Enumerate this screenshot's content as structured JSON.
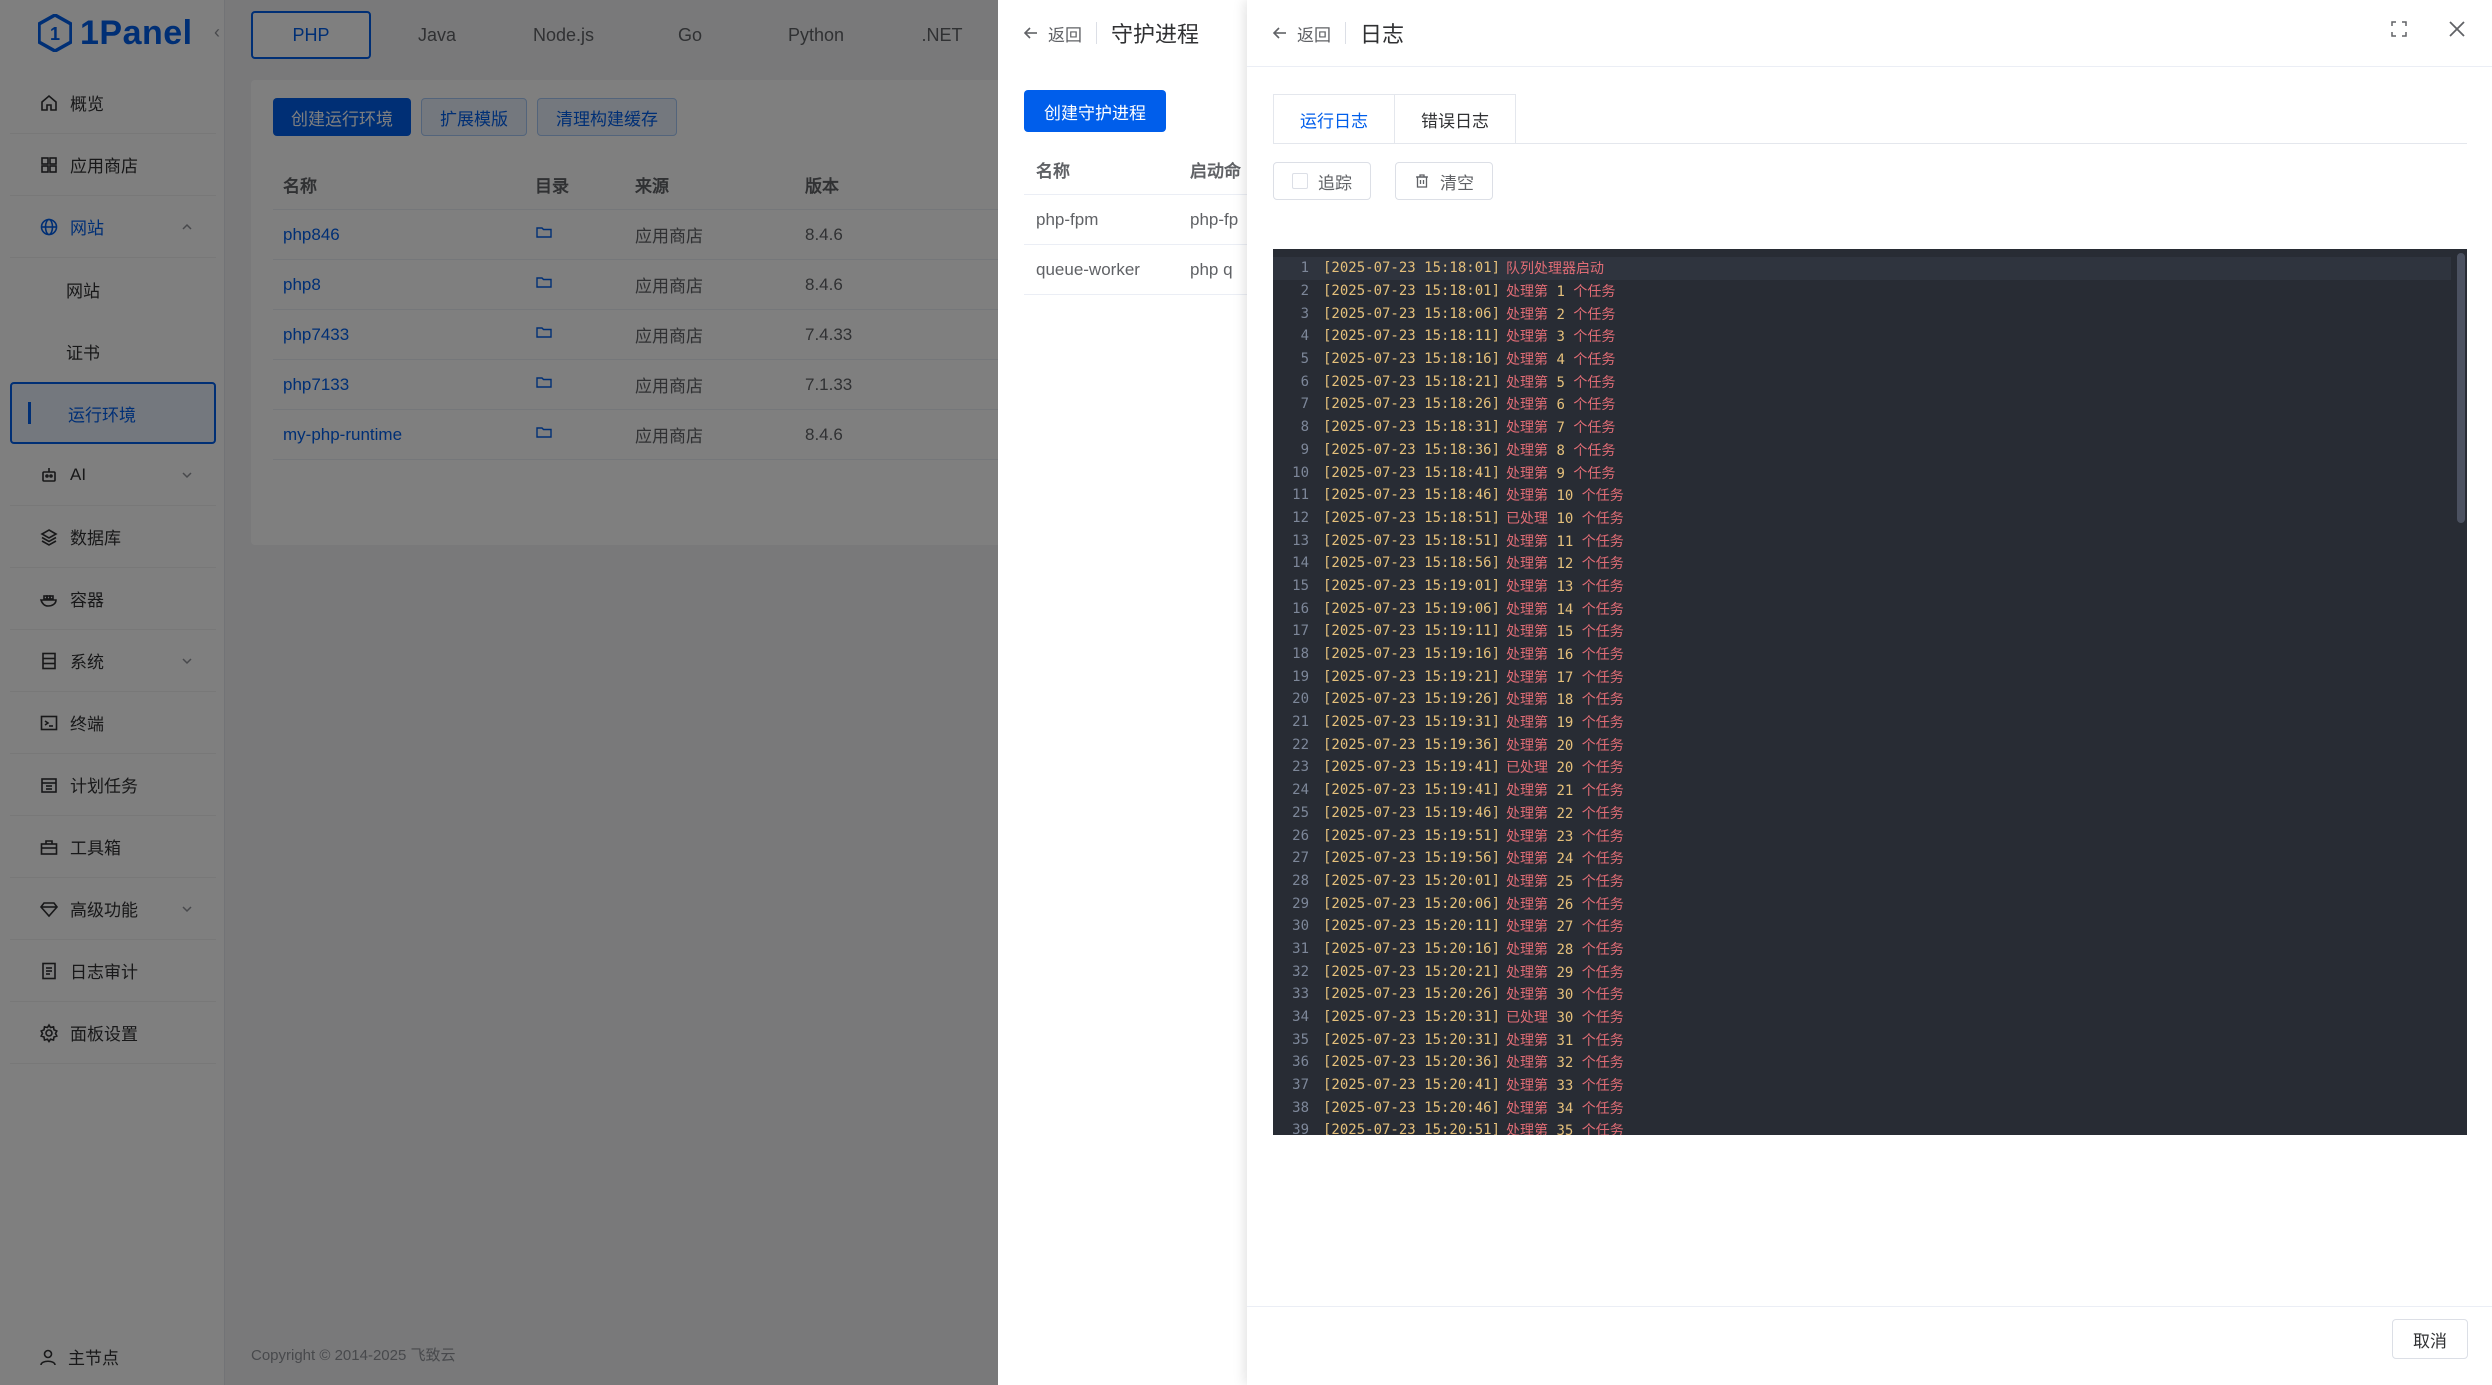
{
  "brand": {
    "name": "1Panel",
    "color": "#005eeb"
  },
  "sidebar": {
    "items": [
      {
        "label": "概览",
        "icon": "home-icon"
      },
      {
        "label": "应用商店",
        "icon": "grid-icon"
      },
      {
        "label": "网站",
        "icon": "globe-icon",
        "expanded": true
      },
      {
        "label": "AI",
        "icon": "robot-icon"
      },
      {
        "label": "数据库",
        "icon": "layers-icon"
      },
      {
        "label": "容器",
        "icon": "docker-icon"
      },
      {
        "label": "系统",
        "icon": "server-icon"
      },
      {
        "label": "终端",
        "icon": "terminal-icon"
      },
      {
        "label": "计划任务",
        "icon": "calendar-icon"
      },
      {
        "label": "工具箱",
        "icon": "toolbox-icon"
      },
      {
        "label": "高级功能",
        "icon": "diamond-icon"
      },
      {
        "label": "日志审计",
        "icon": "file-list-icon"
      },
      {
        "label": "面板设置",
        "icon": "gear-icon"
      }
    ],
    "website_sub": [
      "网站",
      "证书",
      "运行环境"
    ],
    "node": "主节点"
  },
  "runtime": {
    "tabs": [
      "PHP",
      "Java",
      "Node.js",
      "Go",
      "Python",
      ".NET"
    ],
    "buttons": {
      "create": "创建运行环境",
      "extend": "扩展模版",
      "clear_cache": "清理构建缓存"
    },
    "columns": {
      "name": "名称",
      "dir": "目录",
      "source": "来源",
      "version": "版本"
    },
    "rows": [
      {
        "name": "php846",
        "source": "应用商店",
        "version": "8.4.6"
      },
      {
        "name": "php8",
        "source": "应用商店",
        "version": "8.4.6"
      },
      {
        "name": "php7433",
        "source": "应用商店",
        "version": "7.4.33"
      },
      {
        "name": "php7133",
        "source": "应用商店",
        "version": "7.1.33"
      },
      {
        "name": "my-php-runtime",
        "source": "应用商店",
        "version": "8.4.6"
      }
    ],
    "copyright": "Copyright © 2014-2025 飞致云"
  },
  "daemon": {
    "back": "返回",
    "title": "守护进程",
    "create_button": "创建守护进程",
    "columns": {
      "name": "名称",
      "start": "启动命"
    },
    "rows": [
      {
        "name": "php-fpm",
        "cmd": "php-fp"
      },
      {
        "name": "queue-worker",
        "cmd": "php q"
      }
    ]
  },
  "log": {
    "back": "返回",
    "title": "日志",
    "tabs": {
      "run": "运行日志",
      "error": "错误日志"
    },
    "follow": "追踪",
    "clear": "清空",
    "cancel": "取消",
    "lines": [
      {
        "ts": "[2025-07-23 15:18:01]",
        "msg": "队列处理器启动"
      },
      {
        "ts": "[2025-07-23 15:18:01]",
        "pre": "处理第",
        "num": "1",
        "post": "个任务"
      },
      {
        "ts": "[2025-07-23 15:18:06]",
        "pre": "处理第",
        "num": "2",
        "post": "个任务"
      },
      {
        "ts": "[2025-07-23 15:18:11]",
        "pre": "处理第",
        "num": "3",
        "post": "个任务"
      },
      {
        "ts": "[2025-07-23 15:18:16]",
        "pre": "处理第",
        "num": "4",
        "post": "个任务"
      },
      {
        "ts": "[2025-07-23 15:18:21]",
        "pre": "处理第",
        "num": "5",
        "post": "个任务"
      },
      {
        "ts": "[2025-07-23 15:18:26]",
        "pre": "处理第",
        "num": "6",
        "post": "个任务"
      },
      {
        "ts": "[2025-07-23 15:18:31]",
        "pre": "处理第",
        "num": "7",
        "post": "个任务"
      },
      {
        "ts": "[2025-07-23 15:18:36]",
        "pre": "处理第",
        "num": "8",
        "post": "个任务"
      },
      {
        "ts": "[2025-07-23 15:18:41]",
        "pre": "处理第",
        "num": "9",
        "post": "个任务"
      },
      {
        "ts": "[2025-07-23 15:18:46]",
        "pre": "处理第",
        "num": "10",
        "post": "个任务"
      },
      {
        "ts": "[2025-07-23 15:18:51]",
        "pre": "已处理",
        "num": "10",
        "post": "个任务"
      },
      {
        "ts": "[2025-07-23 15:18:51]",
        "pre": "处理第",
        "num": "11",
        "post": "个任务"
      },
      {
        "ts": "[2025-07-23 15:18:56]",
        "pre": "处理第",
        "num": "12",
        "post": "个任务"
      },
      {
        "ts": "[2025-07-23 15:19:01]",
        "pre": "处理第",
        "num": "13",
        "post": "个任务"
      },
      {
        "ts": "[2025-07-23 15:19:06]",
        "pre": "处理第",
        "num": "14",
        "post": "个任务"
      },
      {
        "ts": "[2025-07-23 15:19:11]",
        "pre": "处理第",
        "num": "15",
        "post": "个任务"
      },
      {
        "ts": "[2025-07-23 15:19:16]",
        "pre": "处理第",
        "num": "16",
        "post": "个任务"
      },
      {
        "ts": "[2025-07-23 15:19:21]",
        "pre": "处理第",
        "num": "17",
        "post": "个任务"
      },
      {
        "ts": "[2025-07-23 15:19:26]",
        "pre": "处理第",
        "num": "18",
        "post": "个任务"
      },
      {
        "ts": "[2025-07-23 15:19:31]",
        "pre": "处理第",
        "num": "19",
        "post": "个任务"
      },
      {
        "ts": "[2025-07-23 15:19:36]",
        "pre": "处理第",
        "num": "20",
        "post": "个任务"
      },
      {
        "ts": "[2025-07-23 15:19:41]",
        "pre": "已处理",
        "num": "20",
        "post": "个任务"
      },
      {
        "ts": "[2025-07-23 15:19:41]",
        "pre": "处理第",
        "num": "21",
        "post": "个任务"
      },
      {
        "ts": "[2025-07-23 15:19:46]",
        "pre": "处理第",
        "num": "22",
        "post": "个任务"
      },
      {
        "ts": "[2025-07-23 15:19:51]",
        "pre": "处理第",
        "num": "23",
        "post": "个任务"
      },
      {
        "ts": "[2025-07-23 15:19:56]",
        "pre": "处理第",
        "num": "24",
        "post": "个任务"
      },
      {
        "ts": "[2025-07-23 15:20:01]",
        "pre": "处理第",
        "num": "25",
        "post": "个任务"
      },
      {
        "ts": "[2025-07-23 15:20:06]",
        "pre": "处理第",
        "num": "26",
        "post": "个任务"
      },
      {
        "ts": "[2025-07-23 15:20:11]",
        "pre": "处理第",
        "num": "27",
        "post": "个任务"
      },
      {
        "ts": "[2025-07-23 15:20:16]",
        "pre": "处理第",
        "num": "28",
        "post": "个任务"
      },
      {
        "ts": "[2025-07-23 15:20:21]",
        "pre": "处理第",
        "num": "29",
        "post": "个任务"
      },
      {
        "ts": "[2025-07-23 15:20:26]",
        "pre": "处理第",
        "num": "30",
        "post": "个任务"
      },
      {
        "ts": "[2025-07-23 15:20:31]",
        "pre": "已处理",
        "num": "30",
        "post": "个任务"
      },
      {
        "ts": "[2025-07-23 15:20:31]",
        "pre": "处理第",
        "num": "31",
        "post": "个任务"
      },
      {
        "ts": "[2025-07-23 15:20:36]",
        "pre": "处理第",
        "num": "32",
        "post": "个任务"
      },
      {
        "ts": "[2025-07-23 15:20:41]",
        "pre": "处理第",
        "num": "33",
        "post": "个任务"
      },
      {
        "ts": "[2025-07-23 15:20:46]",
        "pre": "处理第",
        "num": "34",
        "post": "个任务"
      },
      {
        "ts": "[2025-07-23 15:20:51]",
        "pre": "处理第",
        "num": "35",
        "post": "个任务"
      }
    ]
  }
}
